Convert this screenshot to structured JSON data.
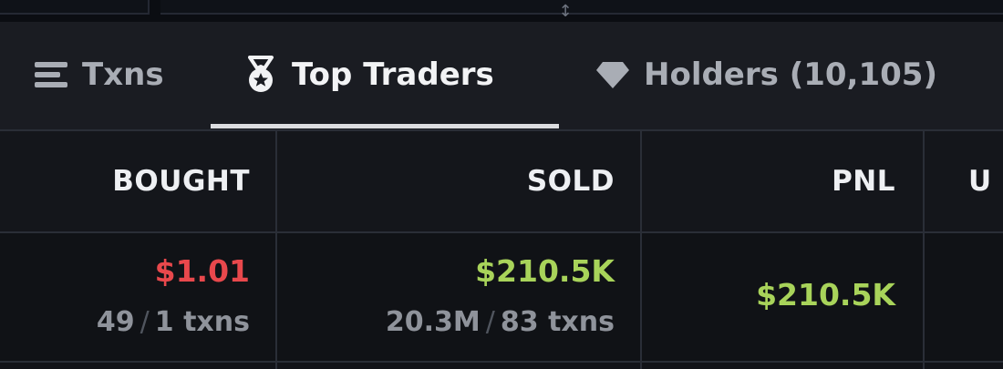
{
  "tabs": [
    {
      "label": "Txns",
      "icon": "list-icon",
      "active": false
    },
    {
      "label": "Top Traders",
      "icon": "medal-icon",
      "active": true
    },
    {
      "label": "Holders (10,105)",
      "icon": "diamond-icon",
      "active": false
    }
  ],
  "table": {
    "columns": [
      "BOUGHT",
      "SOLD",
      "PNL",
      "U"
    ],
    "rows": [
      {
        "bought": {
          "amount": "$1.01",
          "qty": "49",
          "txns": "1 txns"
        },
        "sold": {
          "amount": "$210.5K",
          "qty": "20.3M",
          "txns": "83 txns"
        },
        "pnl": "$210.5K"
      }
    ]
  },
  "colors": {
    "negative": "#e8484c",
    "positive": "#a8d35a",
    "background": "#121419",
    "tab_bar": "#1a1c22"
  }
}
